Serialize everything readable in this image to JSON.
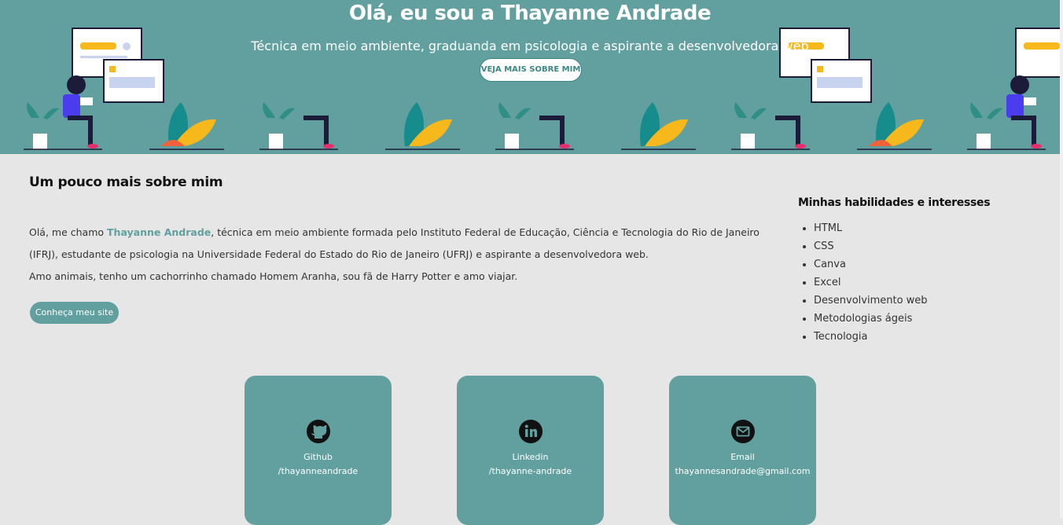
{
  "hero": {
    "title": "Olá, eu sou a Thayanne Andrade",
    "subtitle": "Técnica em meio ambiente, graduanda em psicologia e aspirante a desenvolvedora web",
    "button_label": "VEJA MAIS SOBRE MIM"
  },
  "about": {
    "title": "Um pouco mais sobre mim",
    "text_before_name": "Olá, me chamo ",
    "name": "Thayanne Andrade",
    "text_after_name": ", técnica em meio ambiente formada pelo Instituto Federal de Educação, Ciência e Tecnologia do Rio de Janeiro (IFRJ), estudante de psicologia na Universidade Federal do Estado do Rio de Janeiro (UFRJ) e aspirante a desenvolvedora web.",
    "line2": "Amo animais, tenho um cachorrinho chamado Homem Aranha, sou fã de Harry Potter e amo viajar.",
    "button_label": "Conheça meu site"
  },
  "skills": {
    "title": "Minhas habilidades e interesses",
    "items": [
      "HTML",
      "CSS",
      "Canva",
      "Excel",
      "Desenvolvimento web",
      "Metodologias ágeis",
      "Tecnologia"
    ]
  },
  "contacts": [
    {
      "label": "Github",
      "value": "/thayanneandrade",
      "icon": "github-icon"
    },
    {
      "label": "Linkedin",
      "value": "/thayanne-andrade",
      "icon": "linkedin-icon"
    },
    {
      "label": "Email",
      "value": "thayannesandrade@gmail.com",
      "icon": "email-icon"
    }
  ],
  "colors": {
    "accent": "#61a09e",
    "background": "#e6e6e6"
  }
}
